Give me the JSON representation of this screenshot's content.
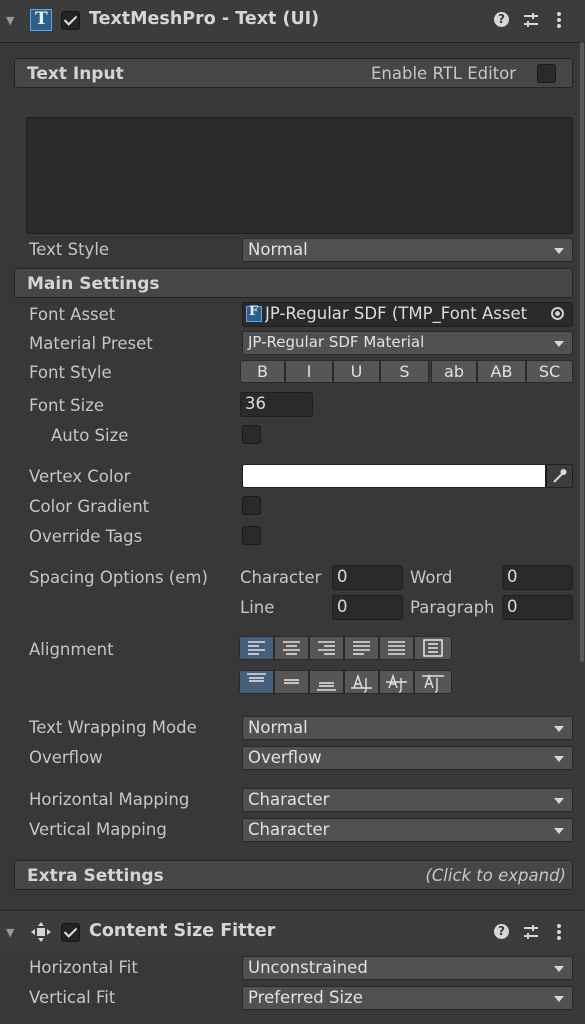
{
  "tmp_component": {
    "title": "TextMeshPro - Text (UI)",
    "icon_letter": "T",
    "enabled": true
  },
  "text_input": {
    "header": "Text Input",
    "rtl_label": "Enable RTL Editor",
    "text": "",
    "text_style_label": "Text Style",
    "text_style_value": "Normal"
  },
  "main_settings": {
    "header": "Main Settings",
    "font_asset_label": "Font Asset",
    "font_asset_value": "JP-Regular SDF (TMP_Font Asset",
    "font_asset_icon_letter": "F",
    "material_preset_label": "Material Preset",
    "material_preset_value": "JP-Regular SDF Material",
    "font_style_label": "Font Style",
    "font_style_buttons": [
      "B",
      "I",
      "U",
      "S",
      "ab",
      "AB",
      "SC"
    ],
    "font_size_label": "Font Size",
    "font_size_value": "36",
    "auto_size_label": "Auto Size",
    "vertex_color_label": "Vertex Color",
    "vertex_color": "#ffffff",
    "color_gradient_label": "Color Gradient",
    "override_tags_label": "Override Tags",
    "spacing_label": "Spacing Options (em)",
    "character_label": "Character",
    "character_value": "0",
    "word_label": "Word",
    "word_value": "0",
    "line_label": "Line",
    "line_value": "0",
    "paragraph_label": "Paragraph",
    "paragraph_value": "0",
    "alignment_label": "Alignment",
    "horizontal_alignment_icons": [
      "align-left-icon",
      "align-center-icon",
      "align-right-icon",
      "align-justified-icon",
      "align-flush-icon",
      "align-geometry-center-icon"
    ],
    "vertical_alignment_icons": [
      "align-top-icon",
      "align-middle-icon",
      "align-bottom-icon",
      "align-baseline-icon",
      "align-midline-icon",
      "align-capline-icon"
    ],
    "selected_horizontal": "align-left-icon",
    "selected_vertical": "align-top-icon",
    "text_wrapping_label": "Text Wrapping Mode",
    "text_wrapping_value": "Normal",
    "overflow_label": "Overflow",
    "overflow_value": "Overflow",
    "horizontal_mapping_label": "Horizontal Mapping",
    "horizontal_mapping_value": "Character",
    "vertical_mapping_label": "Vertical Mapping",
    "vertical_mapping_value": "Character"
  },
  "extra_settings": {
    "header": "Extra Settings",
    "hint": "(Click to expand)"
  },
  "content_size_fitter": {
    "title": "Content Size Fitter",
    "enabled": true,
    "horizontal_fit_label": "Horizontal Fit",
    "horizontal_fit_value": "Unconstrained",
    "vertical_fit_label": "Vertical Fit",
    "vertical_fit_value": "Preferred Size"
  },
  "colors": {
    "panel_bg": "#383838",
    "selected_button": "#46607c",
    "tmp_icon": "#3d8fd6"
  }
}
